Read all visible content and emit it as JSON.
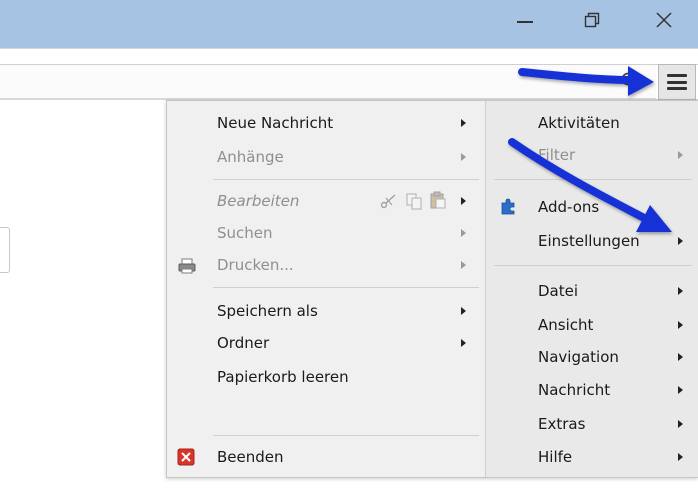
{
  "window": {
    "minimize_icon": "minimize-icon",
    "maximize_icon": "restore-icon",
    "close_icon": "close-icon"
  },
  "toolbar": {
    "menu_icon": "hamburger-menu-icon",
    "search_icon": "search-icon"
  },
  "menu": {
    "left": [
      {
        "label": "Neue Nachricht",
        "submenu": true,
        "enabled": true
      },
      {
        "label": "Anhänge",
        "submenu": true,
        "enabled": false
      },
      {
        "label": "Bearbeiten",
        "submenu": true,
        "enabled": false,
        "italic": true
      },
      {
        "label": "Suchen",
        "submenu": true,
        "enabled": false
      },
      {
        "label": "Drucken...",
        "submenu": true,
        "enabled": false,
        "icon": "printer-icon"
      },
      {
        "label": "Speichern als",
        "submenu": true,
        "enabled": true
      },
      {
        "label": "Ordner",
        "submenu": true,
        "enabled": true
      },
      {
        "label": "Papierkorb leeren",
        "submenu": false,
        "enabled": true
      },
      {
        "label": "Beenden",
        "submenu": false,
        "enabled": true,
        "icon": "exit-icon"
      }
    ],
    "edit_icons": [
      "cut-icon",
      "copy-icon",
      "paste-icon"
    ],
    "right": [
      {
        "label": "Aktivitäten",
        "submenu": false
      },
      {
        "label": "Filter",
        "submenu": true,
        "enabled": false
      },
      {
        "label": "Add-ons",
        "submenu": false,
        "icon": "puzzle-icon"
      },
      {
        "label": "Einstellungen",
        "submenu": true
      },
      {
        "label": "Datei",
        "submenu": true
      },
      {
        "label": "Ansicht",
        "submenu": true
      },
      {
        "label": "Navigation",
        "submenu": true
      },
      {
        "label": "Nachricht",
        "submenu": true
      },
      {
        "label": "Extras",
        "submenu": true
      },
      {
        "label": "Hilfe",
        "submenu": true
      }
    ]
  },
  "colors": {
    "titlebar": "#a7c3e4",
    "annotation_arrow": "#1433d6",
    "addons_icon": "#2a6ec9",
    "exit_icon": "#d9342c"
  }
}
